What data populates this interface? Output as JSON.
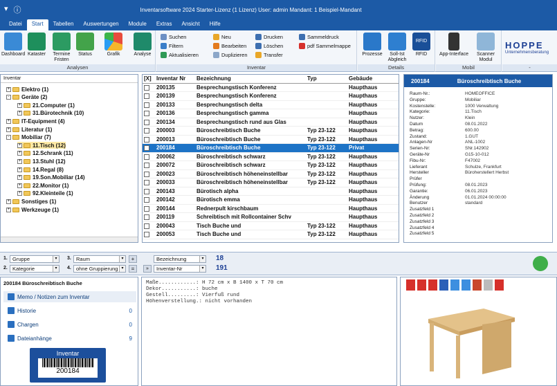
{
  "titlebar": {
    "title": "Inventarsoftware 2024 Starter-Lizenz (1 Lizenz)   User: admin   Mandant: 1 Beispiel-Mandant"
  },
  "menu": [
    "Datei",
    "Start",
    "Tabellen",
    "Auswertungen",
    "Module",
    "Extras",
    "Ansicht",
    "Hilfe"
  ],
  "ribbon": {
    "analysen": {
      "label": "Analysen",
      "buttons": [
        "Dashboard",
        "Kataster",
        "Termine Fristen",
        "Status",
        "Grafik",
        "Analyse"
      ]
    },
    "inventar": {
      "label": "Inventar",
      "col1": [
        "Suchen",
        "Filtern",
        "Aktualisieren"
      ],
      "col2": [
        "Neu",
        "Bearbeiten",
        "Duplizieren"
      ],
      "col3": [
        "Drucken",
        "Löschen",
        "Transfer"
      ],
      "col4": [
        "Sammeldruck",
        "pdf Sammelmappe"
      ]
    },
    "details": {
      "label": "Details",
      "buttons": [
        "Prozesse",
        "Soll-Ist Abgleich",
        "RFID"
      ]
    },
    "mobil": {
      "label": "Mobil",
      "buttons": [
        "App-Interface",
        "Scanner Modul"
      ]
    },
    "brand": {
      "name": "HOPPE",
      "sub": "Unternehmensberatung"
    },
    "extra": {
      "label": "-"
    }
  },
  "tree": {
    "header": "Inventar",
    "nodes": [
      {
        "label": "Elektro  (1)",
        "level": 0,
        "pm": "+"
      },
      {
        "label": "Geräte  (2)",
        "level": 0,
        "pm": "-"
      },
      {
        "label": "21.Computer  (1)",
        "level": 1,
        "pm": "+"
      },
      {
        "label": "31.Bürotechnik  (10)",
        "level": 1,
        "pm": "+"
      },
      {
        "label": "IT-Equipment  (4)",
        "level": 0,
        "pm": "+"
      },
      {
        "label": "Literatur  (1)",
        "level": 0,
        "pm": "+"
      },
      {
        "label": "Mobiliar  (7)",
        "level": 0,
        "pm": "-"
      },
      {
        "label": "11.Tisch  (12)",
        "level": 1,
        "pm": "+",
        "selected": true
      },
      {
        "label": "12.Schrank  (11)",
        "level": 1,
        "pm": "+"
      },
      {
        "label": "13.Stuhl  (12)",
        "level": 1,
        "pm": "+"
      },
      {
        "label": "14.Regal  (8)",
        "level": 1,
        "pm": "+"
      },
      {
        "label": "19.Son.Mobiliar  (14)",
        "level": 1,
        "pm": "+"
      },
      {
        "label": "22.Monitor  (1)",
        "level": 1,
        "pm": "+"
      },
      {
        "label": "92.Kleinteile  (1)",
        "level": 1,
        "pm": "+"
      },
      {
        "label": "Sonstiges  (1)",
        "level": 0,
        "pm": "+"
      },
      {
        "label": "Werkzeuge  (1)",
        "level": 0,
        "pm": "+"
      }
    ]
  },
  "grid": {
    "columns": [
      "[X]",
      "Inventar Nr",
      "Bezeichnung",
      "Typ",
      "Gebäude"
    ],
    "rows": [
      [
        "",
        "200135",
        "Besprechungstisch Konferenz",
        "",
        "Haupthaus"
      ],
      [
        "",
        "200139",
        "Besprechungstisch Konferenz",
        "",
        "Haupthaus"
      ],
      [
        "",
        "200133",
        "Besprechungstisch delta",
        "",
        "Haupthaus"
      ],
      [
        "",
        "200136",
        "Besprechungstisch gamma",
        "",
        "Haupthaus"
      ],
      [
        "",
        "200134",
        "Besprechungstisch rund aus Glas",
        "",
        "Haupthaus"
      ],
      [
        "",
        "200003",
        "Büroschreibtisch  Buche",
        "Typ 23-122",
        "Haupthaus"
      ],
      [
        "",
        "200013",
        "Büroschreibtisch  Buche",
        "Typ 23-122",
        "Haupthaus"
      ],
      [
        "",
        "200184",
        "Büroschreibtisch  Buche",
        "Typ 23-122",
        "Privat"
      ],
      [
        "",
        "200062",
        "Büroschreibtisch  schwarz",
        "Typ 23-122",
        "Haupthaus"
      ],
      [
        "",
        "200072",
        "Büroschreibtisch  schwarz",
        "Typ 23-122",
        "Haupthaus"
      ],
      [
        "",
        "200023",
        "Büroschreibtisch höheneinstellbar",
        "Typ 23-122",
        "Haupthaus"
      ],
      [
        "",
        "200033",
        "Büroschreibtisch höheneinstellbar",
        "Typ 23-122",
        "Haupthaus"
      ],
      [
        "",
        "200143",
        "Bürotisch alpha",
        "",
        "Haupthaus"
      ],
      [
        "",
        "200142",
        "Bürotisch emma",
        "",
        "Haupthaus"
      ],
      [
        "",
        "200144",
        "Rednerpult kirschbaum",
        "",
        "Haupthaus"
      ],
      [
        "",
        "200119",
        "Schreibtisch mit Rollcontainer Schv",
        "",
        "Haupthaus"
      ],
      [
        "",
        "200043",
        "Tisch  Buche  und",
        "Typ 23-122",
        "Haupthaus"
      ],
      [
        "",
        "200053",
        "Tisch  Buche  und",
        "Typ 23-122",
        "Haupthaus"
      ]
    ],
    "selected_index": 7
  },
  "detail": {
    "id": "200184",
    "title": "Büroschreibtisch  Buche",
    "fields": [
      [
        "Raum-Nr.:",
        "HOMEOFFICE"
      ],
      [
        "Gruppe:",
        "Mobiliar"
      ],
      [
        "Kostenstelle:",
        "1000 Verwaltung"
      ],
      [
        "Kategorie:",
        "11.Tisch"
      ],
      [
        "Nutzer:",
        "Klein"
      ],
      [
        "Datum",
        "08.01.2022"
      ],
      [
        "Betrag:",
        "600.00"
      ],
      [
        "Zustand:",
        "1.GUT"
      ],
      [
        "Anlagen-Nr",
        "ANL-1002"
      ],
      [
        "Serien-Nr:",
        "SNr.142902"
      ],
      [
        "Geräte-Nr",
        "G15-10-012"
      ],
      [
        "Fibu-Nr:",
        "F47002"
      ],
      [
        "Lieferant",
        "Schulze, Frankfurt"
      ],
      [
        "Hersteller",
        "Büroherstellert Herbst"
      ],
      [
        "Prüfer",
        ""
      ],
      [
        "Prüfung:",
        "08.01.2023"
      ],
      [
        "Garantie:",
        "06.01.2023"
      ],
      [
        "Änderung",
        "01.01.2024 00:00:00"
      ],
      [
        "Benutzer",
        "standard"
      ],
      [
        "Zusatzfeld 1",
        ""
      ],
      [
        "Zusatzfeld 2",
        ""
      ],
      [
        "Zusatzfeld 3",
        ""
      ],
      [
        "Zusatzfeld 4",
        ""
      ],
      [
        "Zusatzfeld 5",
        ""
      ]
    ]
  },
  "filters": {
    "f1": {
      "num": "1.",
      "value": "Gruppe"
    },
    "f2": {
      "num": "2.",
      "value": "Kategorie"
    },
    "f3": {
      "num": "3.",
      "value": "Raum"
    },
    "f4": {
      "num": "4.",
      "value": "ohne Gruppierung"
    },
    "sort1": "Bezeichnung",
    "sort2": "Inventar-Nr",
    "count1": "18",
    "count2": "191"
  },
  "bottom_left": {
    "title": "200184 Büroschreibtisch  Buche",
    "items": [
      [
        "Memo / Notizen zum Inventar",
        ""
      ],
      [
        "Historie",
        "0"
      ],
      [
        "Chargen",
        "0"
      ],
      [
        "Dateianhänge",
        "9"
      ]
    ],
    "label_title": "Inventar",
    "label_id": "200184"
  },
  "memo": [
    "Maße............: H 72 cm x B 1400 x T 70 cm",
    "Dekor...........: buche",
    "Gestell.........: Vierfuß rund",
    "Höhenverstellung.: nicht vorhanden"
  ]
}
